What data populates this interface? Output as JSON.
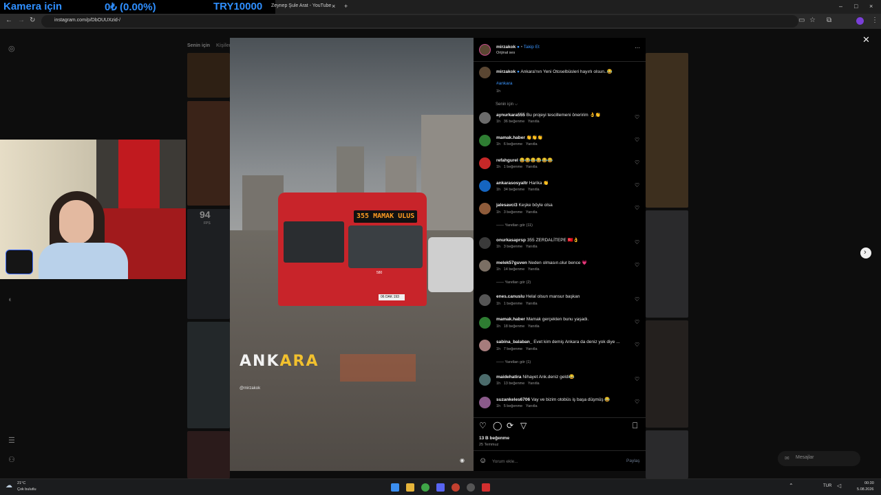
{
  "overlay": {
    "label1": "Kamera için",
    "label2": "0₺ (0.00%)",
    "label3": "TRY10000"
  },
  "browser": {
    "tab_title": "Zeynep Şule Arat - YouTube",
    "url": "instagram.com/p/DbOUUXzid-/",
    "new_tab": "+",
    "tab_close": "×",
    "win_min": "–",
    "win_max": "□",
    "win_close": "×"
  },
  "feed": {
    "tab_for_you": "Senin için",
    "tab_people": "Kişiler",
    "badge_count": "94",
    "badge_unit": "FPS"
  },
  "video": {
    "bus_sign": "355 MAMAK ULUS",
    "overlay_title_a": "ANK",
    "overlay_title_b": "ARA",
    "credit": "@mirzakok",
    "plate": "06 DAK 193",
    "bus_number": "580"
  },
  "post": {
    "author": "mirzakok",
    "follow": "Takip Et",
    "audio": "Orijinal ses",
    "more": "···",
    "caption": "Ankara'nın Yeni Otoselbüsleri hayırlı olsun..",
    "caption_emoji": "😂",
    "hashtag": "#ankara",
    "caption_time": "1h",
    "sort": "Senin için ⌵",
    "comments": [
      {
        "user": "aynurkara555",
        "text": "Bu projeyi tescillemeni öneririm 👌👏",
        "time": "1h",
        "likes": "36 beğenme",
        "reply": "Yanıtla"
      },
      {
        "user": "mamak.haber",
        "text": "👏👏👏",
        "time": "1h",
        "likes": "6 beğenme",
        "reply": "Yanıtla"
      },
      {
        "user": "refahgurel",
        "text": "😂😂😂😂😂😂",
        "time": "1h",
        "likes": "1 beğenme",
        "reply": "Yanıtla"
      },
      {
        "user": "ankarasosyaltr",
        "text": "Harika 👏",
        "time": "1h",
        "likes": "34 beğenme",
        "reply": "Yanıtla"
      },
      {
        "user": "jalesavci3",
        "text": "Keşke böyle olsa",
        "time": "1h",
        "likes": "3 beğenme",
        "reply": "Yanıtla",
        "replies": "Yanıtları gör (11)"
      },
      {
        "user": "onurkasaprsp",
        "text": "355 ZERDALİTEPE 🇹🇷👌",
        "time": "1h",
        "likes": "3 beğenme",
        "reply": "Yanıtla"
      },
      {
        "user": "melek57guven",
        "text": "Neden olmasın.olur bence 💗",
        "time": "1h",
        "likes": "14 beğenme",
        "reply": "Yanıtla",
        "replies": "Yanıtları gör (2)"
      },
      {
        "user": "enes.canuslu",
        "text": "Helal olsun mansur başkan",
        "time": "1h",
        "likes": "1 beğenme",
        "reply": "Yanıtla"
      },
      {
        "user": "mamak.haber",
        "text": "Mamak gerçekten bunu yaşadı.",
        "time": "1h",
        "likes": "18 beğenme",
        "reply": "Yanıtla"
      },
      {
        "user": "sabina_balaban_",
        "text": "Evet kim demiş Ankara da deniz yok diye ...",
        "time": "1h",
        "likes": "7 beğenme",
        "reply": "Yanıtla",
        "replies": "Yanıtları gör (1)"
      },
      {
        "user": "maidehatira",
        "text": "Nihayet Ank.deniz geldi😂",
        "time": "1h",
        "likes": "13 beğenme",
        "reply": "Yanıtla"
      },
      {
        "user": "suzankeles6706",
        "text": "Vay ve bizim otobüs iş başa düşmüş 😂",
        "time": "1h",
        "likes": "5 beğenme",
        "reply": "Yanıtla"
      }
    ],
    "likes_total": "13 B beğenme",
    "date": "25 Temmuz",
    "comment_placeholder": "Yorum ekle...",
    "post_button": "Paylaş"
  },
  "modal": {
    "close": "✕",
    "next": "›"
  },
  "messages": {
    "label": "Mesajlar"
  },
  "taskbar": {
    "weather_temp": "21°C",
    "weather_desc": "Çok bulutlu",
    "lang": "TUR",
    "time": "00:30",
    "date": "5.08.2026"
  },
  "colors": {
    "bus_red": "#d4262b",
    "accent_blue": "#3b96ff",
    "overlay_blue": "#2f8fff",
    "overlay_yellow": "#f2c12e"
  }
}
